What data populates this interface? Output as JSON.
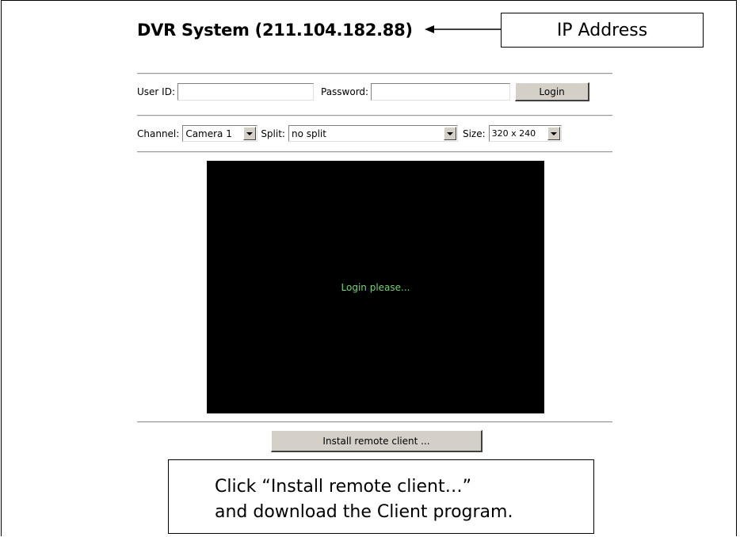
{
  "header": {
    "title": "DVR System (211.104.182.88)"
  },
  "callouts": {
    "ip_label": "IP Address",
    "install_line1": "Click “Install remote client…”",
    "install_line2": "and download the Client program."
  },
  "login": {
    "user_label": "User ID:",
    "user_value": "",
    "password_label": "Password:",
    "password_value": "",
    "login_button": "Login"
  },
  "controls": {
    "channel_label": "Channel:",
    "channel_value": "Camera 1",
    "split_label": "Split:",
    "split_value": "no split",
    "size_label": "Size:",
    "size_value": "320 x 240"
  },
  "video": {
    "status_text": "Login please..."
  },
  "install_button": "Install remote client ..."
}
